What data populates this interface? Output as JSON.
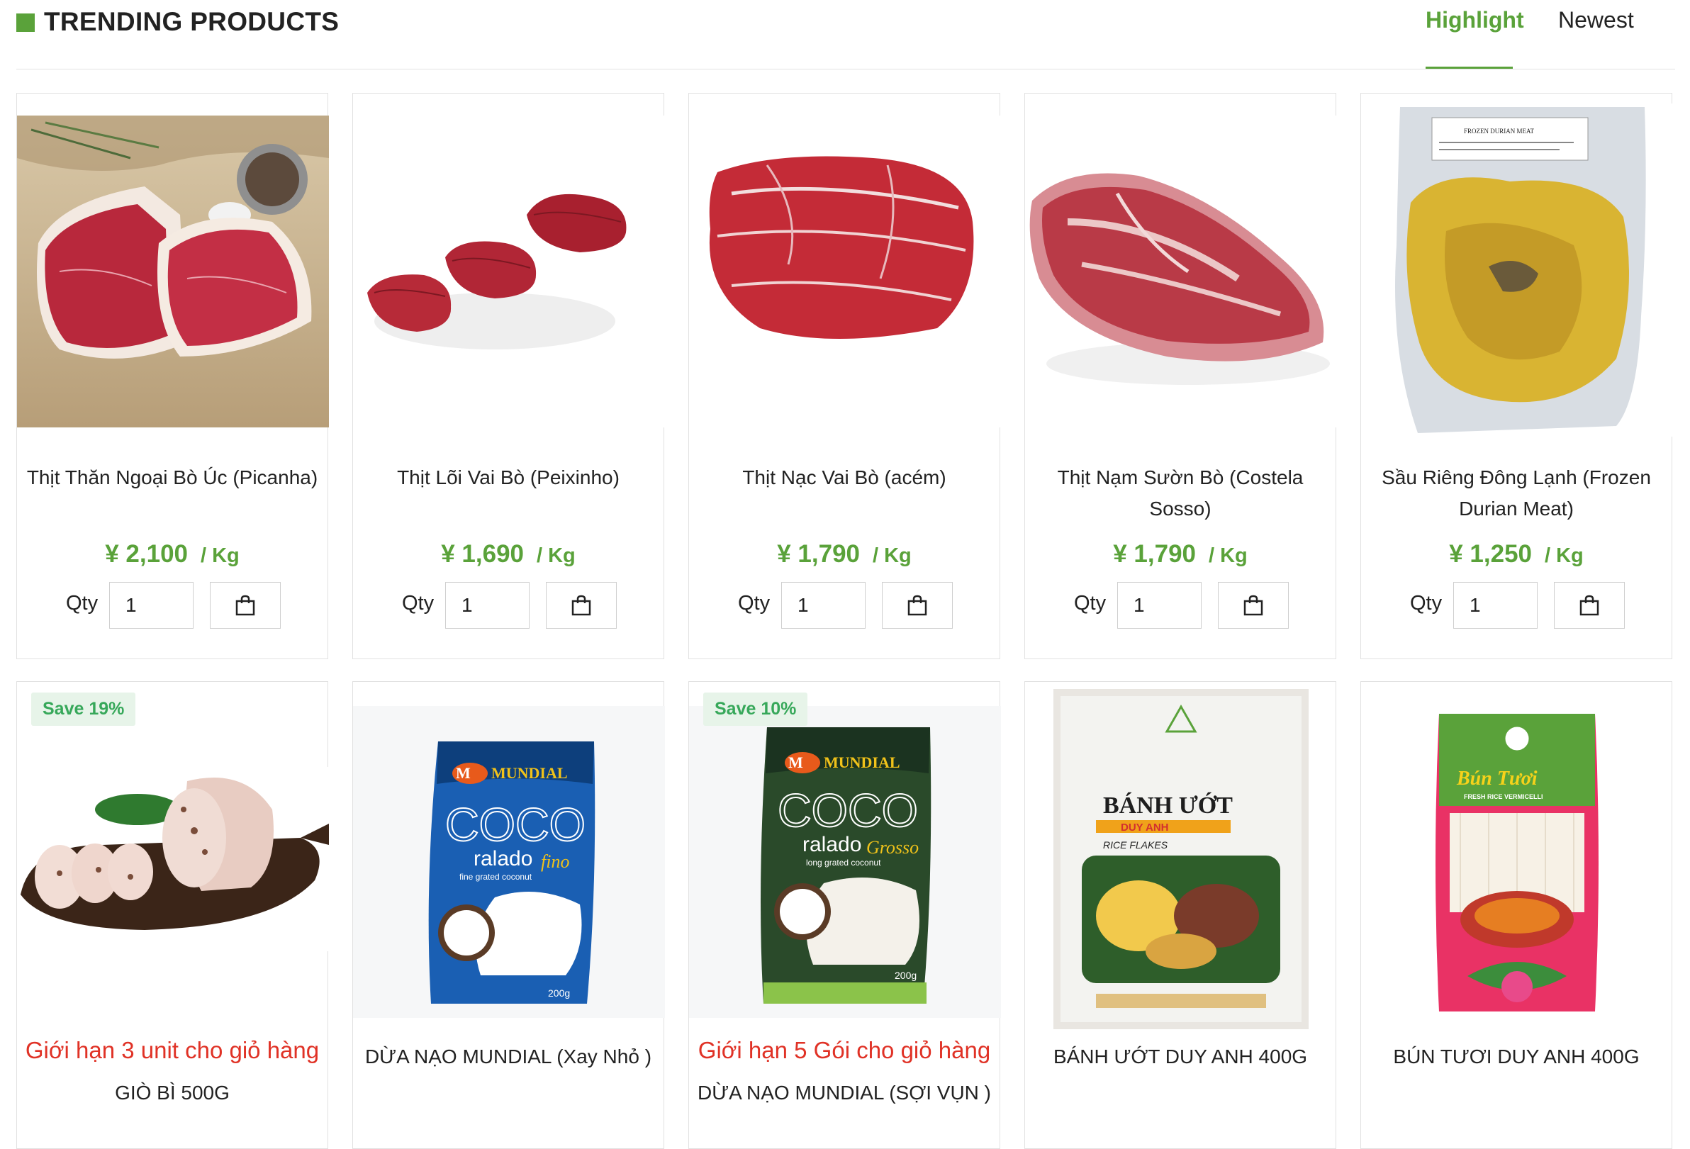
{
  "header": {
    "title": "TRENDING PRODUCTS",
    "tabs": [
      {
        "label": "Highlight",
        "active": true
      },
      {
        "label": "Newest",
        "active": false
      }
    ],
    "accent_color": "#5aa23a"
  },
  "common": {
    "qty_label": "Qty",
    "qty_value": "1",
    "cart_icon": "shopping-bag-icon"
  },
  "row1": [
    {
      "name": "Thịt Thăn Ngoại Bò Úc (Picanha)",
      "price": "¥ 2,100",
      "unit": "/ Kg",
      "image": "beef-steak-picanha"
    },
    {
      "name": "Thịt Lõi Vai Bò (Peixinho)",
      "price": "¥ 1,690",
      "unit": "/ Kg",
      "image": "beef-peixinho-slices"
    },
    {
      "name": "Thịt Nạc Vai Bò (acém)",
      "price": "¥ 1,790",
      "unit": "/ Kg",
      "image": "beef-acem-slices"
    },
    {
      "name": "Thịt Nạm Sườn Bò (Costela Sosso)",
      "price": "¥ 1,790",
      "unit": "/ Kg",
      "image": "beef-brisket"
    },
    {
      "name": "Sầu Riêng Đông Lạnh (Frozen Durian Meat)",
      "price": "¥ 1,250",
      "unit": "/ Kg",
      "image": "frozen-durian-pack"
    }
  ],
  "row2": [
    {
      "badge": "Save 19%",
      "limit": "Giới hạn 3 unit cho giỏ hàng",
      "name": "GIÒ BÌ 500G",
      "image": "gio-bi-sausage"
    },
    {
      "badge": "",
      "limit": "",
      "name": "DỪA NẠO MUNDIAL (Xay Nhỏ )",
      "image": "coco-ralado-fino-pack"
    },
    {
      "badge": "Save 10%",
      "limit": "Giới hạn 5 Gói cho giỏ hàng",
      "name": "DỪA NẠO MUNDIAL (SỢI VỤN )",
      "image": "coco-ralado-grosso-pack"
    },
    {
      "badge": "",
      "limit": "",
      "name": "BÁNH ƯỚT DUY ANH 400G",
      "image": "banh-uot-pack"
    },
    {
      "badge": "",
      "limit": "",
      "name": "BÚN TƯƠI DUY ANH 400G",
      "image": "bun-tuoi-pack"
    }
  ],
  "package_text": {
    "mundial_brand": "MUNDIAL",
    "coco": "COCO",
    "ralado": "ralado",
    "fino": "fino",
    "fine_grated": "fine grated coconut",
    "grosso": "Grosso",
    "long_grated": "long grated coconut",
    "weight": "200g",
    "banh_uot_title": "BÁNH ƯỚT",
    "duy_anh": "DUY ANH",
    "rice_flakes": "RICE FLAKES",
    "bun_tuoi_title": "Bún Tươi",
    "fresh_rice": "FRESH RICE VERMICELLI",
    "frozen_durian_label": "FROZEN DURIAN MEAT"
  }
}
